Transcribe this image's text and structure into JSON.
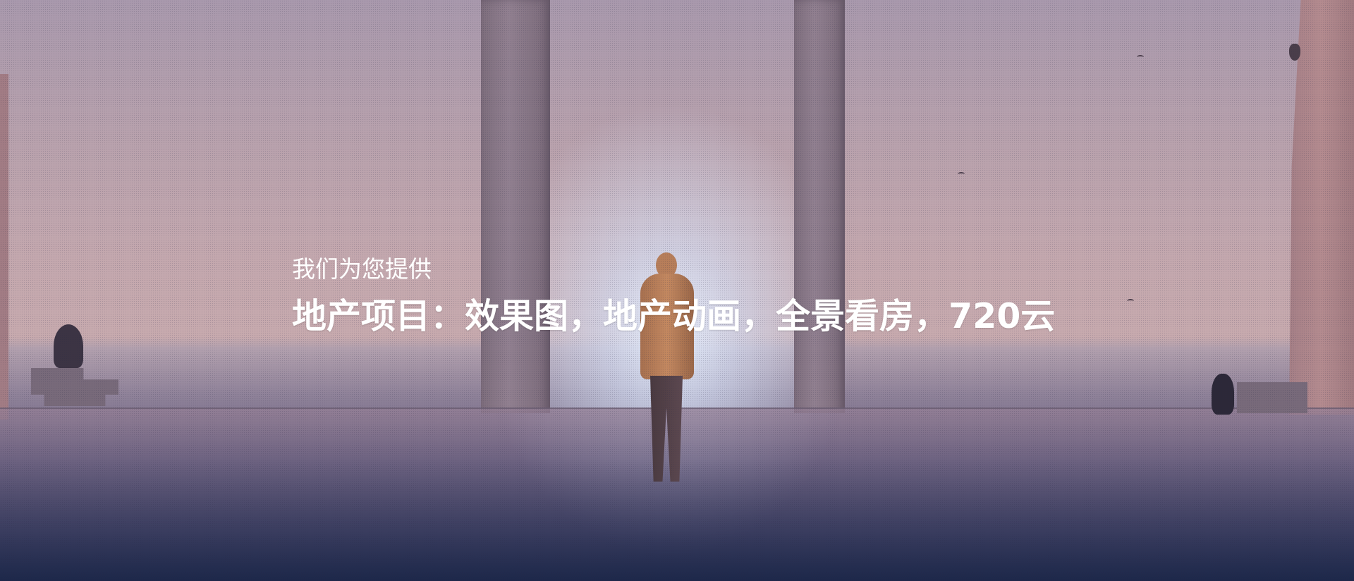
{
  "hero": {
    "subtitle": "我们为您提供",
    "headline": "地产项目：效果图，地产动画，全景看房，720云"
  },
  "colors": {
    "text": "#ffffff",
    "sky_top": "#a999ad",
    "sky_mid": "#c7aaae",
    "bottom_navy": "#1d284a",
    "glow": "#e6f0ff"
  }
}
